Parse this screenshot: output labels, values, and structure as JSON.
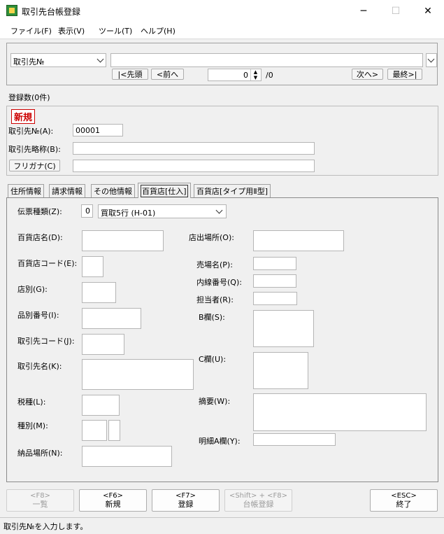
{
  "window": {
    "title": "取引先台帳登録",
    "minimize": "─",
    "maximize": "☐",
    "close": "✕"
  },
  "menu": [
    "ファイル(F)",
    "表示(V)",
    "ツール(T)",
    "ヘルプ(H)"
  ],
  "search": {
    "field_select": "取引先№",
    "value": "",
    "first_button": "|<先頭",
    "prev_button": "<前へ",
    "record_number": "0",
    "record_total": "/0",
    "next_button": "次へ>",
    "last_button": "最終>|"
  },
  "registration_count": "登録数(0件)",
  "new_badge": "新規",
  "header": {
    "client_no_label": "取引先№(A):",
    "client_no_value": "00001",
    "short_name_label": "取引先略称(B):",
    "short_name_value": "",
    "furigana_button": "フリガナ(C)",
    "furigana_value": ""
  },
  "tabs": [
    "住所情報",
    "請求情報",
    "その他情報",
    "百貨店[仕入]",
    "百貨店[タイプ用Ⅱ型]"
  ],
  "active_tab": 3,
  "form": {
    "slip_type_label": "伝票種類(Z):",
    "slip_type_number": "0",
    "slip_type_value": "買取5行 (H-01)",
    "store_name_label": "百貨店名(D):",
    "store_code_label": "百貨店コード(E):",
    "store_branch_label": "店別(G):",
    "item_no_label": "品別番号(I):",
    "client_code_label": "取引先コード(J):",
    "client_name_label": "取引先名(K):",
    "tax_type_label": "税種(L):",
    "category_label": "種別(M):",
    "delivery_place_label": "納品場所(N):",
    "outlet_label": "店出場所(O):",
    "sales_floor_label": "売場名(P):",
    "extension_label": "内線番号(Q):",
    "person_label": "担当者(R):",
    "b_column_label": "B欄(S):",
    "c_column_label": "C欄(U):",
    "summary_label": "摘要(W):",
    "detail_a_label": "明細A欄(Y):"
  },
  "function_keys": [
    {
      "key": "<F8>",
      "label": "一覧",
      "enabled": false
    },
    {
      "key": "<F6>",
      "label": "新規",
      "enabled": true
    },
    {
      "key": "<F7>",
      "label": "登録",
      "enabled": true
    },
    {
      "key": "<Shift> + <F8>",
      "label": "台帳登録",
      "enabled": false
    },
    {
      "key": "<ESC>",
      "label": "終了",
      "enabled": true
    }
  ],
  "status_text": "取引先№を入力します。"
}
